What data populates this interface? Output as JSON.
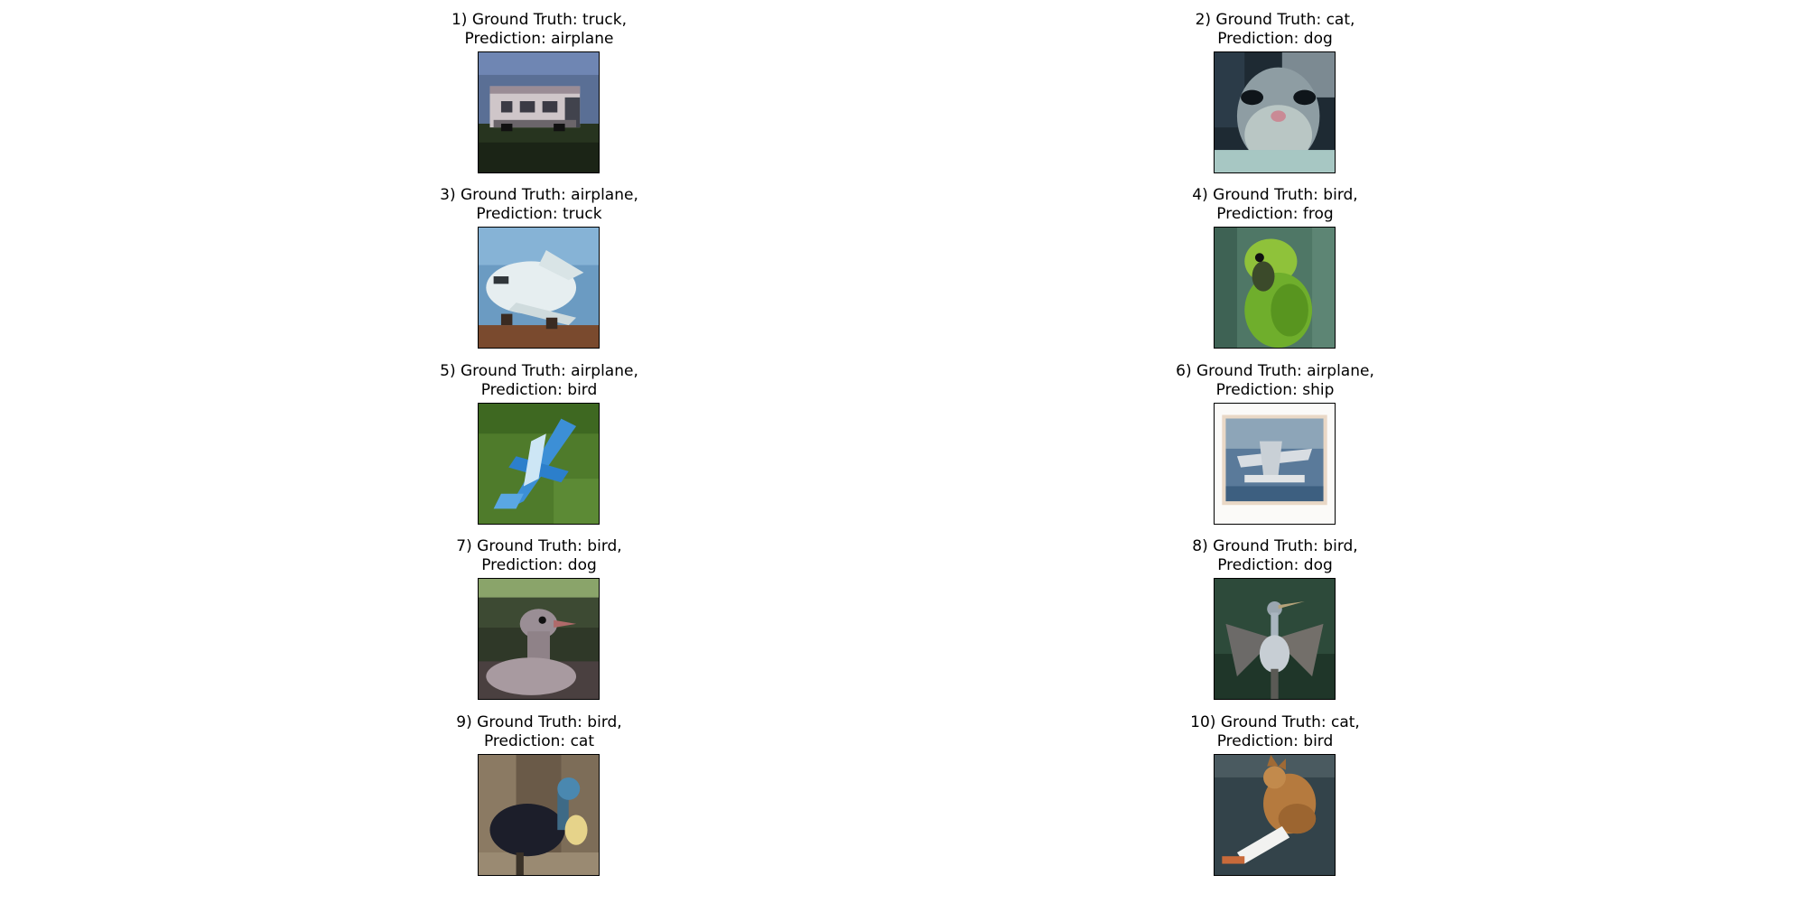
{
  "panels": [
    {
      "line1": "1) Ground Truth: truck,",
      "line2": "Prediction: airplane",
      "image": "truck-photo"
    },
    {
      "line1": "2) Ground Truth: cat,",
      "line2": "Prediction: dog",
      "image": "cat-photo"
    },
    {
      "line1": "3) Ground Truth: airplane,",
      "line2": "Prediction: truck",
      "image": "airplane-photo"
    },
    {
      "line1": "4) Ground Truth: bird,",
      "line2": "Prediction: frog",
      "image": "parrot-photo"
    },
    {
      "line1": "5) Ground Truth: airplane,",
      "line2": "Prediction: bird",
      "image": "toy-airplane-photo"
    },
    {
      "line1": "6) Ground Truth: airplane,",
      "line2": "Prediction: ship",
      "image": "seaplane-photo"
    },
    {
      "line1": "7) Ground Truth: bird,",
      "line2": "Prediction: dog",
      "image": "ostrich-photo"
    },
    {
      "line1": "8) Ground Truth: bird,",
      "line2": "Prediction: dog",
      "image": "heron-photo"
    },
    {
      "line1": "9) Ground Truth: bird,",
      "line2": "Prediction: cat",
      "image": "cassowary-photo"
    },
    {
      "line1": "10) Ground Truth: cat,",
      "line2": "Prediction: bird",
      "image": "cat-lying-photo"
    }
  ]
}
